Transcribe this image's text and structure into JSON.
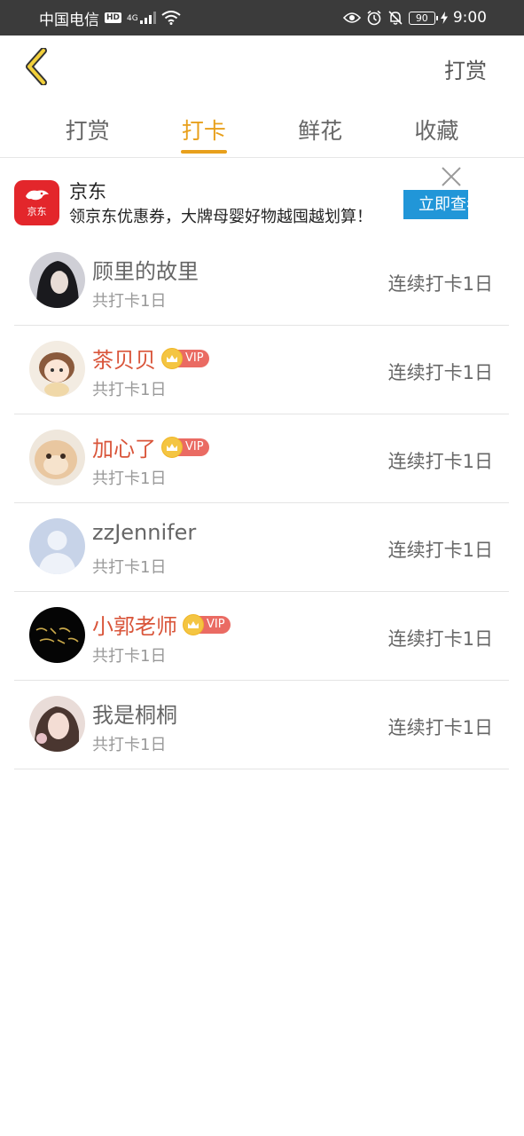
{
  "status_bar": {
    "carrier": "中国电信",
    "hd": "HD",
    "network": "4G",
    "battery": "90",
    "time": "9:00"
  },
  "topbar": {
    "reward_label": "打赏"
  },
  "tabs": [
    {
      "label": "打赏",
      "active": false
    },
    {
      "label": "打卡",
      "active": true
    },
    {
      "label": "鲜花",
      "active": false
    },
    {
      "label": "收藏",
      "active": false
    }
  ],
  "ad": {
    "logo_text": "京东",
    "title": "京东",
    "description": "领京东优惠券，大牌母婴好物越囤越划算！",
    "cta": "立即查看"
  },
  "colors": {
    "accent": "#e8a01c",
    "vip_name": "#d9553a",
    "ad_cta": "#2196d8",
    "jd_red": "#e3262b"
  },
  "users": [
    {
      "name": "顾里的故里",
      "vip": false,
      "total": "共打卡1日",
      "streak": "连续打卡1日"
    },
    {
      "name": "茶贝贝",
      "vip": true,
      "vip_label": "VIP",
      "total": "共打卡1日",
      "streak": "连续打卡1日"
    },
    {
      "name": "加心了",
      "vip": true,
      "vip_label": "VIP",
      "total": "共打卡1日",
      "streak": "连续打卡1日"
    },
    {
      "name": "zzJennifer",
      "vip": false,
      "total": "共打卡1日",
      "streak": "连续打卡1日"
    },
    {
      "name": "小郭老师",
      "vip": true,
      "vip_label": "VIP",
      "total": "共打卡1日",
      "streak": "连续打卡1日"
    },
    {
      "name": "我是桐桐",
      "vip": false,
      "total": "共打卡1日",
      "streak": "连续打卡1日"
    }
  ]
}
